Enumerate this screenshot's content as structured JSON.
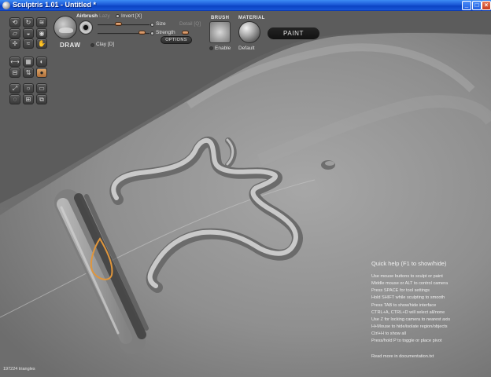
{
  "window": {
    "title": "Sculptris 1.01 - Untitled *",
    "minimize_glyph": "_",
    "maximize_glyph": "□",
    "close_glyph": "×"
  },
  "toolbar": {
    "tool_label": "DRAW",
    "airbrush_label": "Airbrush",
    "lazy_label": "Lazy",
    "invert_label": "Invert [X]",
    "size_label": "Size",
    "detail_label": "Detail [Q]",
    "strength_label": "Strength",
    "options_label": "OPTIONS",
    "clay_label": "Clay [D]",
    "brush_header": "BRUSH",
    "brush_enable_label": "Enable",
    "material_header": "MATERIAL",
    "material_name": "Default",
    "paint_label": "PAINT"
  },
  "tools": [
    {
      "icon": "rotate-icon",
      "glyph": "⟲"
    },
    {
      "icon": "twist-icon",
      "glyph": "↻"
    },
    {
      "icon": "crease-icon",
      "glyph": "≋"
    },
    {
      "icon": "flatten-icon",
      "glyph": "▱"
    },
    {
      "icon": "draw-icon",
      "glyph": "◒"
    },
    {
      "icon": "inflate-icon",
      "glyph": "◉"
    },
    {
      "icon": "pinch-icon",
      "glyph": "✢"
    },
    {
      "icon": "smooth-icon",
      "glyph": "≈"
    },
    {
      "icon": "grab-icon",
      "glyph": "✋"
    },
    {
      "icon": "symmetry-icon",
      "glyph": "⟷"
    },
    {
      "icon": "wireframe-icon",
      "glyph": "▦"
    },
    {
      "icon": "mask-icon",
      "glyph": "◐"
    },
    {
      "icon": "reduce-icon",
      "glyph": "⊟"
    },
    {
      "icon": "invert-icon",
      "glyph": "⇅"
    },
    {
      "icon": "active-brush-icon",
      "glyph": "●",
      "active": true
    },
    {
      "icon": "scale-icon",
      "glyph": "⤢"
    },
    {
      "icon": "sphere-icon",
      "glyph": "○"
    },
    {
      "icon": "plane-icon",
      "glyph": "▭"
    },
    {
      "icon": "hide-icon",
      "glyph": "◌"
    },
    {
      "icon": "subdivide-icon",
      "glyph": "⊞"
    },
    {
      "icon": "mirror-icon",
      "glyph": "⧉"
    }
  ],
  "help": {
    "title": "Quick help (F1 to show/hide)",
    "lines": [
      "Use mouse buttons to sculpt or paint",
      "Middle mouse or ALT to control camera",
      "Press SPACE for tool settings",
      "Hold SHIFT while sculpting to smooth",
      "Press TAB to show/hide interface",
      "CTRL+A, CTRL+D will select all/none",
      "Use Z for locking camera to nearest axis",
      "H+Mouse to hide/isolate region/objects",
      "Ctrl+H to show all",
      "Press/hold P to toggle or place pivot"
    ],
    "footer": "Read more in documentation.txt"
  },
  "status": {
    "triangles": "197224 triangles"
  },
  "colors": {
    "brush_cursor": "#e0963c",
    "accent_slider": "#d99a68"
  }
}
